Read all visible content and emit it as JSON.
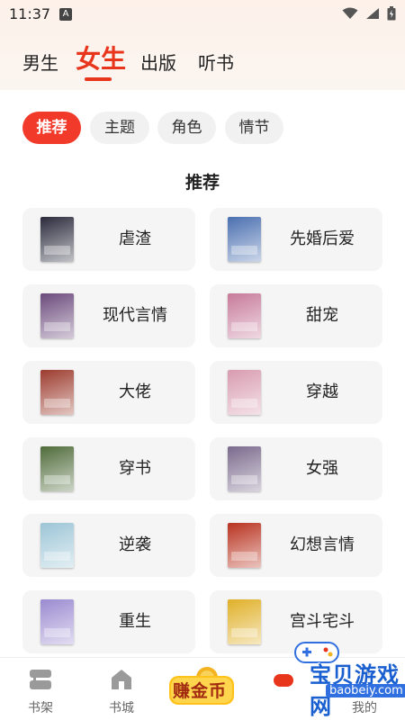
{
  "status_bar": {
    "time": "11:37",
    "a_badge": "A"
  },
  "top_tabs": [
    {
      "label": "男生"
    },
    {
      "label": "女生"
    },
    {
      "label": "出版"
    },
    {
      "label": "听书"
    }
  ],
  "filter_chips": [
    {
      "label": "推荐"
    },
    {
      "label": "主题"
    },
    {
      "label": "角色"
    },
    {
      "label": "情节"
    }
  ],
  "section": {
    "title": "推荐"
  },
  "categories": [
    {
      "label": "虐渣",
      "cover_color": "#2a2a3c"
    },
    {
      "label": "先婚后爱",
      "cover_color": "#4a6fb0"
    },
    {
      "label": "现代言情",
      "cover_color": "#6b4a7c"
    },
    {
      "label": "甜宠",
      "cover_color": "#c77a9a"
    },
    {
      "label": "大佬",
      "cover_color": "#9c3b2e"
    },
    {
      "label": "穿越",
      "cover_color": "#d89bb0"
    },
    {
      "label": "穿书",
      "cover_color": "#4f6b3a"
    },
    {
      "label": "女强",
      "cover_color": "#7a6a8c"
    },
    {
      "label": "逆袭",
      "cover_color": "#9cc5d6"
    },
    {
      "label": "幻想言情",
      "cover_color": "#b8321f"
    },
    {
      "label": "重生",
      "cover_color": "#9a8ad0"
    },
    {
      "label": "宫斗宅斗",
      "cover_color": "#e0b028"
    }
  ],
  "bottom_nav": [
    {
      "label": "书架"
    },
    {
      "label": "书城"
    },
    {
      "label": ""
    },
    {
      "label": "我的"
    }
  ],
  "earn_coin": {
    "label": "赚金币"
  },
  "watermark": {
    "title": "宝贝游戏网",
    "url": "baobeiy.com"
  },
  "colors": {
    "accent": "#e8361d",
    "chip_active": "#f23a2a",
    "card_bg": "#f5f5f5"
  }
}
